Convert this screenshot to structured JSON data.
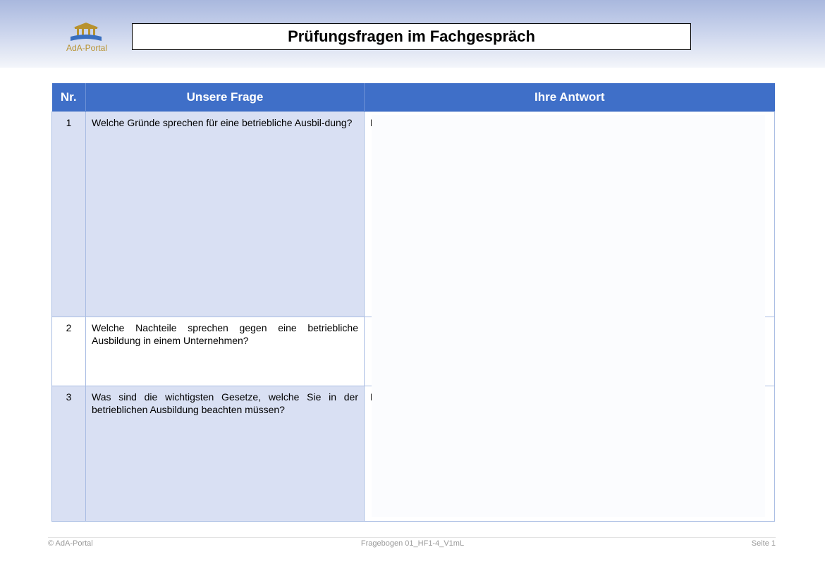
{
  "header": {
    "logo_text": "AdA-Portal",
    "title": "Prüfungsfragen im Fachgespräch"
  },
  "table": {
    "columns": [
      "Nr.",
      "Unsere Frage",
      "Ihre Antwort"
    ],
    "rows": [
      {
        "nr": "1",
        "question": "Welche Gründe sprechen für eine betriebliche Ausbil-dung?",
        "answer_start": "D"
      },
      {
        "nr": "2",
        "question": "Welche Nachteile sprechen gegen eine betriebliche Ausbildung in einem Unternehmen?",
        "answer_start": ""
      },
      {
        "nr": "3",
        "question": "Was sind die wichtigsten Gesetze, welche Sie in der betrieblichen Ausbildung beachten müssen?",
        "answer_start": "D"
      }
    ]
  },
  "footer": {
    "left": "© AdA-Portal",
    "center": "Fragebogen 01_HF1-4_V1mL",
    "right": "Seite 1"
  },
  "colors": {
    "header_fill": "#3f6fc8",
    "row_shade": "#d9e0f3",
    "logo_gold": "#b8922f",
    "logo_blue": "#3a6fbf"
  }
}
